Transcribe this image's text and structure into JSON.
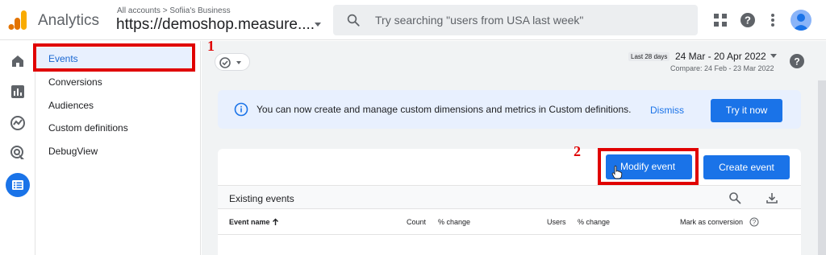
{
  "header": {
    "app_title": "Analytics",
    "account_path": "All accounts > Sofiia's Business",
    "property_name": "https://demoshop.measure....",
    "search_placeholder": "Try searching \"users from USA last week\""
  },
  "subnav": {
    "items": [
      {
        "label": "Events",
        "selected": true
      },
      {
        "label": "Conversions"
      },
      {
        "label": "Audiences"
      },
      {
        "label": "Custom definitions"
      },
      {
        "label": "DebugView"
      }
    ]
  },
  "rail": {
    "icons": [
      "home-icon",
      "reports-icon",
      "explore-icon",
      "advertising-icon",
      "configure-icon"
    ]
  },
  "date": {
    "chip": "Last 28 days",
    "range": "24 Mar - 20 Apr 2022",
    "compare": "Compare: 24 Feb - 23 Mar 2022"
  },
  "banner": {
    "text": "You can now create and manage custom dimensions and metrics in Custom definitions.",
    "dismiss": "Dismiss",
    "try_label": "Try it now"
  },
  "card": {
    "modify_label": "Modify event",
    "create_label": "Create event",
    "existing_title": "Existing events",
    "columns": {
      "event_name": "Event name",
      "count": "Count",
      "pct_change_1": "% change",
      "users": "Users",
      "pct_change_2": "% change",
      "mark_conversion": "Mark as conversion"
    }
  },
  "annotations": {
    "step1": "1",
    "step2": "2"
  },
  "colors": {
    "accent": "#1a73e8",
    "highlight": "#e00000",
    "banner_bg": "#e8f0fe"
  }
}
